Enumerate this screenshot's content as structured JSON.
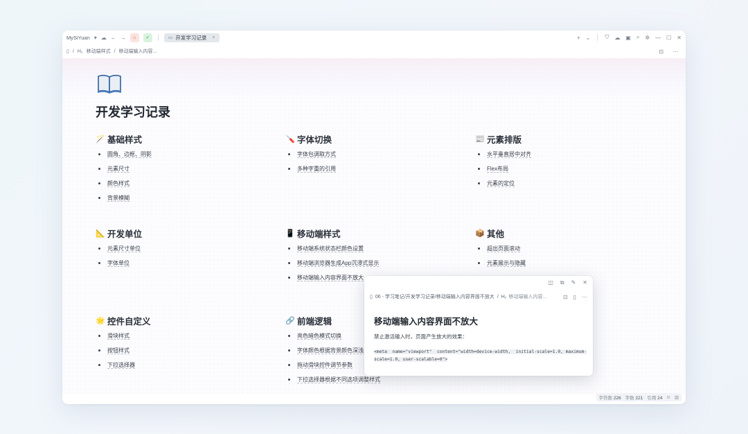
{
  "titlebar": {
    "user": "MySiYuan",
    "tab_label": "开发学习记录"
  },
  "breadcrumb": {
    "heading_marker": "H₂",
    "doc_item": "移动端样式",
    "current": "移动端输入内容..."
  },
  "document": {
    "title": "开发学习记录",
    "sections": [
      {
        "emoji": "🪄",
        "title": "基础样式",
        "items": [
          "圆角、边框、阴影",
          "元素尺寸",
          "颜色样式",
          "背景模糊"
        ]
      },
      {
        "emoji": "🪛",
        "title": "字体切换",
        "items": [
          "字体包调取方式",
          "多种字重的引用"
        ]
      },
      {
        "emoji": "📰",
        "title": "元素排版",
        "items": [
          "水平垂直居中对齐",
          "Flex布局",
          "元素的定位"
        ]
      },
      {
        "emoji": "📐",
        "title": "开发单位",
        "items": [
          "元素尺寸单位",
          "字体单位"
        ]
      },
      {
        "emoji": "📱",
        "title": "移动端样式",
        "items": [
          "移动端系统状态栏颜色设置",
          "移动端浏览器生成App沉浸式显示",
          "移动端输入内容界面不放大"
        ]
      },
      {
        "emoji": "📦",
        "title": "其他",
        "items": [
          "超出页面滚动",
          "元素展示与隐藏"
        ]
      },
      {
        "emoji": "🌟",
        "title": "控件自定义",
        "items": [
          "滑块样式",
          "按钮样式",
          "下拉选择器"
        ]
      },
      {
        "emoji": "🔗",
        "title": "前端逻辑",
        "items": [
          "亮色暗色模式切换",
          "字体颜色根据背景颜色深浅自",
          "拖动滑块控件调节参数",
          "下拉选择器根据不同选项调整样式"
        ]
      }
    ]
  },
  "popup": {
    "path": "06 - 学习笔记/开发学习记录/移动端输入内容界面不放大",
    "heading_marker": "H₂",
    "crumb_current": "移动端输入内容...",
    "title": "移动端输入内容界面不放大",
    "desc": "禁止激活输入时，页面产生放大的效果：",
    "code": "<meta  name=\"viewport\"  content=\"width=device-width,  initial-scale=1.0, maximum-scale=1.0, user-scalable=0\">"
  },
  "status": {
    "chars_label": "字符数",
    "chars": "226",
    "words_label": "字数",
    "words": "221",
    "refs_label": "引用",
    "refs": "24"
  },
  "icons": [
    "cloud-icon",
    "back-arrow-icon",
    "forward-arrow-icon",
    "plus-icon",
    "chevron-down-icon",
    "minimize-icon",
    "maximize-icon",
    "close-icon",
    "more-icon",
    "lock-icon",
    "pin-icon"
  ]
}
